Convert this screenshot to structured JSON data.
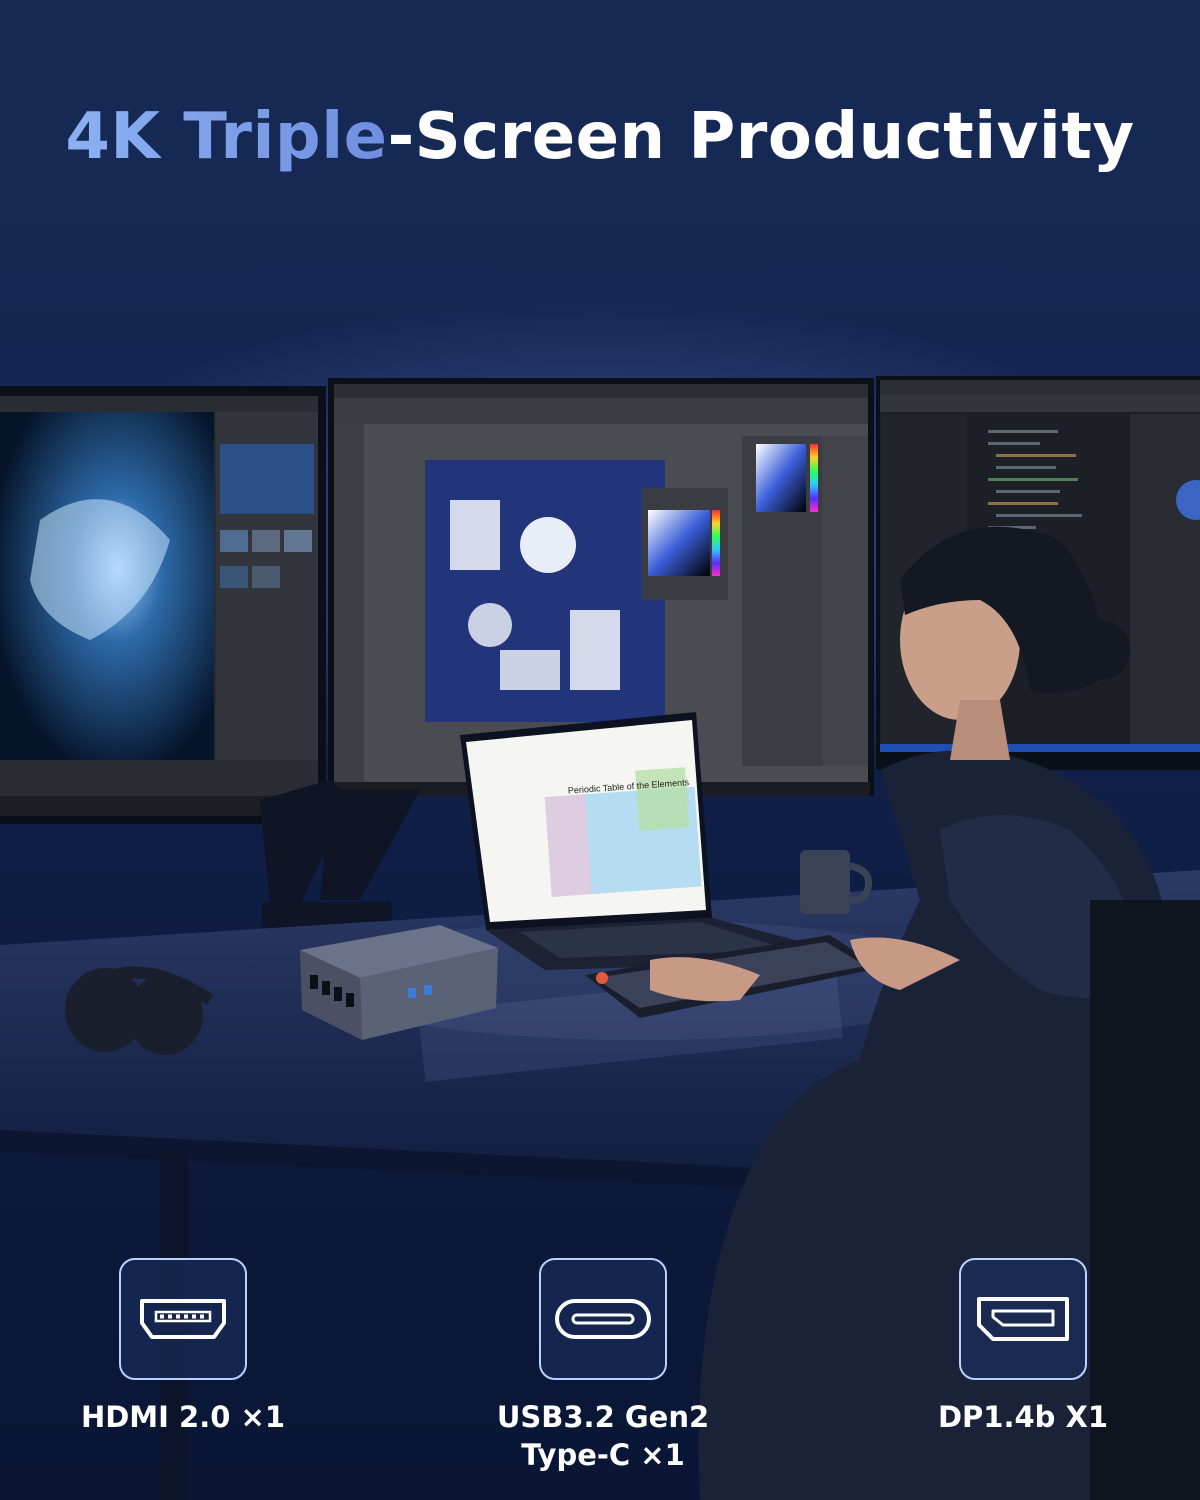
{
  "headline": {
    "highlight": "4K Triple",
    "rest": "-Screen Productivity"
  },
  "scene": {
    "laptop_chart_title": "Periodic Table of the Elements"
  },
  "ports": [
    {
      "icon": "hdmi-port-icon",
      "label_line1": "HDMI 2.0 ×1",
      "label_line2": ""
    },
    {
      "icon": "usb-c-port-icon",
      "label_line1": "USB3.2 Gen2",
      "label_line2": "Type-C ×1"
    },
    {
      "icon": "displayport-icon",
      "label_line1": "DP1.4b X1",
      "label_line2": ""
    }
  ],
  "colors": {
    "background": "#0d1a3b",
    "highlight": "#8cb1f2",
    "icon_border": "#bcd0ff"
  }
}
